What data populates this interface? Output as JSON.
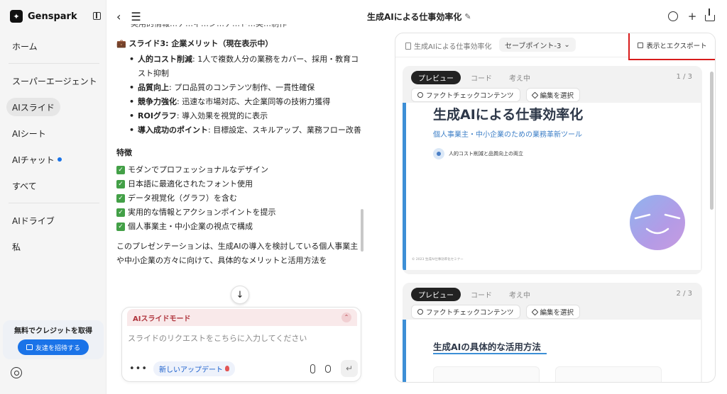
{
  "app": {
    "brand": "Genspark"
  },
  "sidebar": {
    "items": [
      {
        "label": "ホーム"
      },
      {
        "label": "スーパーエージェント"
      },
      {
        "label": "AIスライド"
      },
      {
        "label": "AIシート"
      },
      {
        "label": "AIチャット"
      },
      {
        "label": "すべて"
      },
      {
        "label": "AIドライブ"
      },
      {
        "label": "私"
      }
    ],
    "active": "AIスライド",
    "promo": {
      "text": "無料でクレジットを取得",
      "button": "友達を招待する"
    }
  },
  "chat": {
    "cut_line": "実用的情報…ナ…ィ…ン…ナ…ド…実…制作",
    "slide3_title": "💼 スライド3: 企業メリット（現在表示中）",
    "bullets": [
      {
        "key": "人的コスト削減",
        "text": ": 1人で複数人分の業務をカバー、採用・教育コスト抑制"
      },
      {
        "key": "品質向上",
        "text": ": プロ品質のコンテンツ制作、一貫性確保"
      },
      {
        "key": "競争力強化",
        "text": ": 迅速な市場対応、大企業同等の技術力獲得"
      },
      {
        "key": "ROIグラフ",
        "text": ": 導入効果を視覚的に表示"
      },
      {
        "key": "導入成功のポイント",
        "text": ": 目標設定、スキルアップ、業務フロー改善"
      }
    ],
    "features_title": "特徴",
    "features": [
      "モダンでプロフェッショナルなデザイン",
      "日本語に最適化されたフォント使用",
      "データ視覚化（グラフ）を含む",
      "実用的な情報とアクションポイントを提示",
      "個人事業主・中小企業の視点で構成"
    ],
    "paragraph": "このプレゼンテーションは、生成AIの導入を検討している個人事業主や中小企業の方々に向けて、具体的なメリットと活用方法を"
  },
  "composer": {
    "mode_label": "AIスライドモード",
    "placeholder": "スライドのリクエストをこちらに入力してください",
    "update_label": "新しいアップデート"
  },
  "header": {
    "title": "生成AIによる仕事効率化"
  },
  "preview": {
    "crumb": "生成AIによる仕事効率化",
    "savepoint": "セーブポイント-3",
    "export_label": "表示とエクスポート",
    "tabs": [
      "プレビュー",
      "コード",
      "考え中"
    ],
    "chips": [
      "ファクトチェックコンテンツ",
      "編集を選択"
    ],
    "slides": [
      {
        "page": "1 / 3",
        "title": "生成AIによる仕事効率化",
        "subtitle": "個人事業主・中小企業のための業務革新ツール",
        "point": "人的コスト削減と品質向上の両立",
        "footer": "© 2023 生成AI仕事効率化セミナー"
      },
      {
        "page": "2 / 3",
        "title": "生成AIの具体的な活用方法"
      }
    ]
  },
  "colors": {
    "accent": "#1a73e8",
    "slide_accent": "#3d8fd6",
    "highlight_border": "#d81b1b"
  }
}
